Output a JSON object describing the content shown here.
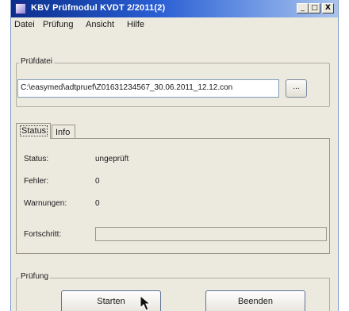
{
  "window": {
    "title": "KBV Prüfmodul KVDT 2/2011(2)",
    "controls": {
      "minimize": "_",
      "maximize": "□",
      "close": "X"
    }
  },
  "menu": {
    "items": [
      "Datei",
      "Prüfung",
      "Ansicht",
      "Hilfe"
    ]
  },
  "pruefdatei": {
    "group_label": "Prüfdatei",
    "path": "C:\\easymed\\adtpruef\\Z01631234567_30.06.2011_12.12.con",
    "browse_label": "..."
  },
  "tabs": [
    {
      "label": "Status",
      "active": true
    },
    {
      "label": "Info",
      "active": false
    }
  ],
  "status_panel": {
    "status_label": "Status:",
    "status_value": "ungeprüft",
    "fehler_label": "Fehler:",
    "fehler_value": "0",
    "warnungen_label": "Warnungen:",
    "warnungen_value": "0",
    "fortschritt_label": "Fortschritt:",
    "progress_percent": 0
  },
  "pruefung": {
    "group_label": "Prüfung",
    "start_label": "Starten",
    "end_label": "Beenden"
  },
  "colors": {
    "titlebar_start": "#0b2e8c",
    "titlebar_end": "#a9c3ec",
    "window_bg": "#ece9df",
    "field_border": "#7f9db9"
  }
}
